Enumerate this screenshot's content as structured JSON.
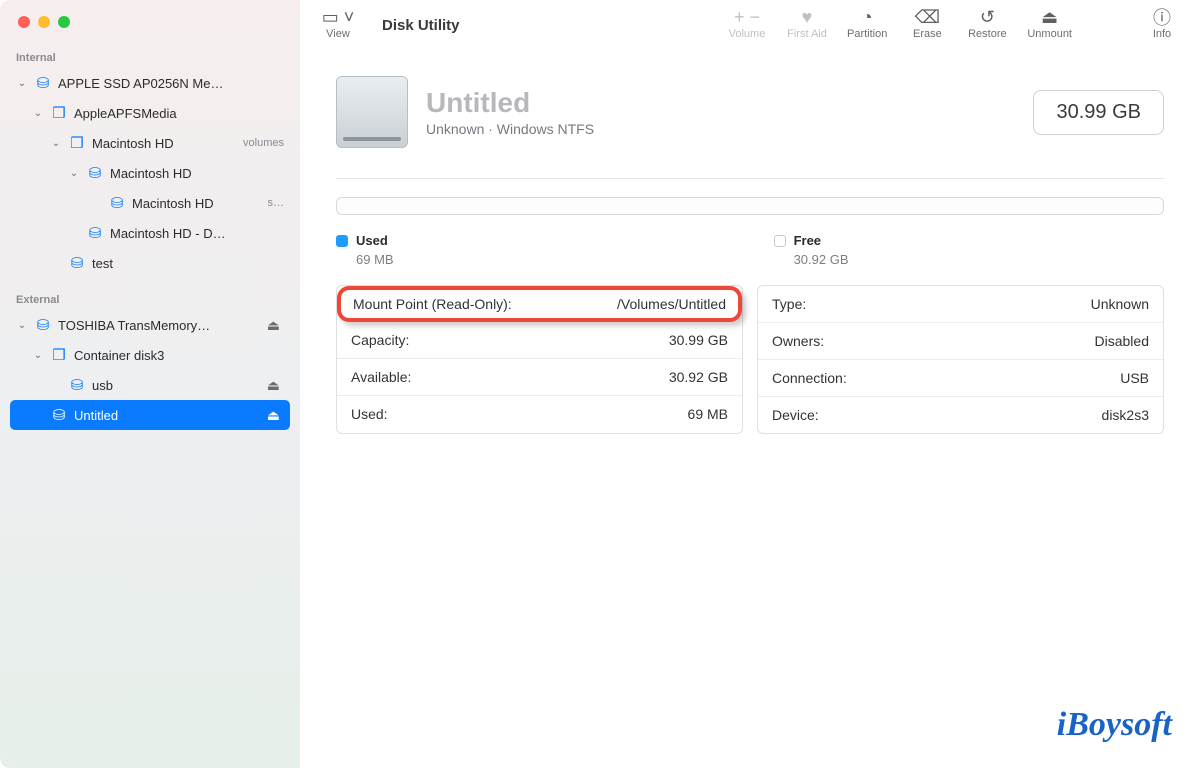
{
  "app_title": "Disk Utility",
  "toolbar": {
    "view": "View",
    "volume": "Volume",
    "firstaid": "First Aid",
    "partition": "Partition",
    "erase": "Erase",
    "restore": "Restore",
    "unmount": "Unmount",
    "info": "Info"
  },
  "sidebar": {
    "sections": {
      "internal": "Internal",
      "external": "External"
    },
    "internal": [
      {
        "label": "APPLE SSD AP0256N Me…",
        "icon": "hdd",
        "chev": true,
        "indent": 0
      },
      {
        "label": "AppleAPFSMedia",
        "icon": "container",
        "chev": true,
        "indent": 1
      },
      {
        "label": "Macintosh HD",
        "tag": "volumes",
        "icon": "container",
        "chev": true,
        "indent": 2
      },
      {
        "label": "Macintosh HD",
        "icon": "hdd",
        "chev": true,
        "indent": 3
      },
      {
        "label": "Macintosh HD",
        "tag": "s…",
        "icon": "hdd",
        "chev": false,
        "indent": 4
      },
      {
        "label": "Macintosh HD - D…",
        "icon": "hdd",
        "chev": false,
        "indent": 3
      },
      {
        "label": "test",
        "icon": "hdd",
        "chev": false,
        "indent": 2
      }
    ],
    "external": [
      {
        "label": "TOSHIBA TransMemory…",
        "icon": "hdd",
        "chev": true,
        "indent": 0,
        "eject": true
      },
      {
        "label": "Container disk3",
        "icon": "container",
        "chev": true,
        "indent": 1
      },
      {
        "label": "usb",
        "icon": "hdd",
        "chev": false,
        "indent": 2,
        "eject": true
      },
      {
        "label": "Untitled",
        "icon": "hdd",
        "chev": false,
        "indent": 1,
        "eject": true,
        "selected": true
      }
    ]
  },
  "volume": {
    "name": "Untitled",
    "subtitle": "Unknown · Windows NTFS",
    "capacity_badge": "30.99 GB"
  },
  "legend": {
    "used_label": "Used",
    "used_val": "69 MB",
    "free_label": "Free",
    "free_val": "30.92 GB"
  },
  "details_left": [
    {
      "k": "Mount Point (Read-Only):",
      "v": "/Volumes/Untitled",
      "callout": true
    },
    {
      "k": "Capacity:",
      "v": "30.99 GB"
    },
    {
      "k": "Available:",
      "v": "30.92 GB"
    },
    {
      "k": "Used:",
      "v": "69 MB"
    }
  ],
  "details_right": [
    {
      "k": "Type:",
      "v": "Unknown"
    },
    {
      "k": "Owners:",
      "v": "Disabled"
    },
    {
      "k": "Connection:",
      "v": "USB"
    },
    {
      "k": "Device:",
      "v": "disk2s3"
    }
  ],
  "brand": "iBoysoft"
}
